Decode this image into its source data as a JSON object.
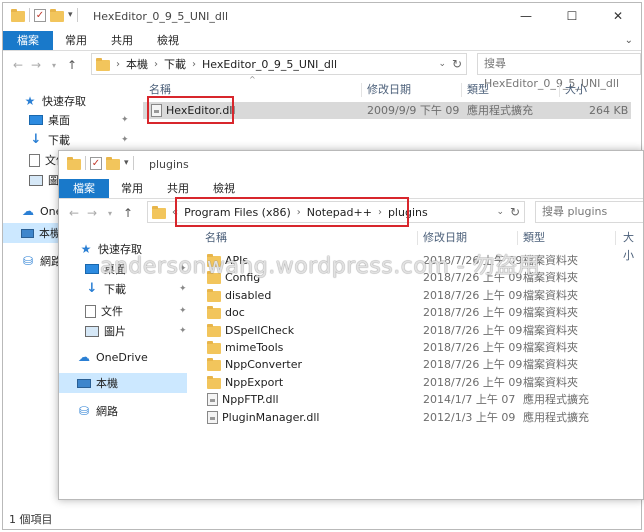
{
  "back_window": {
    "title": "HexEditor_0_9_5_UNI_dll",
    "ribbon_tabs": [
      "檔案",
      "常用",
      "共用",
      "檢視"
    ],
    "breadcrumb": [
      "本機",
      "下載",
      "HexEditor_0_9_5_UNI_dll"
    ],
    "search_placeholder": "搜尋 HexEditor_0_9_5_UNI_dll",
    "columns": [
      "名稱",
      "修改日期",
      "類型",
      "大小"
    ],
    "file": {
      "name": "HexEditor.dll",
      "date": "2009/9/9 下午 09",
      "type": "應用程式擴充",
      "size": "264 KB"
    },
    "sidebar": {
      "quick_access": "快速存取",
      "items": [
        "桌面",
        "下載",
        "文件",
        "圖片"
      ],
      "onedrive": "OneDrive",
      "thispc": "本機",
      "network": "網路"
    },
    "status": "1 個項目"
  },
  "front_window": {
    "title": "plugins",
    "ribbon_tabs": [
      "檔案",
      "常用",
      "共用",
      "檢視"
    ],
    "breadcrumb_prefix": "«",
    "breadcrumb": [
      "Program Files (x86)",
      "Notepad++",
      "plugins"
    ],
    "search_placeholder": "搜尋 plugins",
    "columns": [
      "名稱",
      "修改日期",
      "類型",
      "大小"
    ],
    "sidebar": {
      "quick_access": "快速存取",
      "items": [
        "桌面",
        "下載",
        "文件",
        "圖片"
      ],
      "onedrive": "OneDrive",
      "thispc": "本機",
      "network": "網路"
    },
    "rows": [
      {
        "name": "APIs",
        "date": "2018/7/26 上午 09",
        "type": "檔案資料夾",
        "kind": "folder"
      },
      {
        "name": "Config",
        "date": "2018/7/26 上午 09",
        "type": "檔案資料夾",
        "kind": "folder"
      },
      {
        "name": "disabled",
        "date": "2018/7/26 上午 09",
        "type": "檔案資料夾",
        "kind": "folder"
      },
      {
        "name": "doc",
        "date": "2018/7/26 上午 09",
        "type": "檔案資料夾",
        "kind": "folder"
      },
      {
        "name": "DSpellCheck",
        "date": "2018/7/26 上午 09",
        "type": "檔案資料夾",
        "kind": "folder"
      },
      {
        "name": "mimeTools",
        "date": "2018/7/26 上午 09",
        "type": "檔案資料夾",
        "kind": "folder"
      },
      {
        "name": "NppConverter",
        "date": "2018/7/26 上午 09",
        "type": "檔案資料夾",
        "kind": "folder"
      },
      {
        "name": "NppExport",
        "date": "2018/7/26 上午 09",
        "type": "檔案資料夾",
        "kind": "folder"
      },
      {
        "name": "NppFTP.dll",
        "date": "2014/1/7 上午 07",
        "type": "應用程式擴充",
        "kind": "dll"
      },
      {
        "name": "PluginManager.dll",
        "date": "2012/1/3 上午 09",
        "type": "應用程式擴充",
        "kind": "dll"
      }
    ]
  },
  "watermark": "andersonwang.wordpress.com - 勿盜用",
  "colors": {
    "accent": "#1979ca",
    "highlight_box": "#d8262c",
    "selected_row": "#d9d9d9",
    "nav_selected": "#cce8ff"
  }
}
